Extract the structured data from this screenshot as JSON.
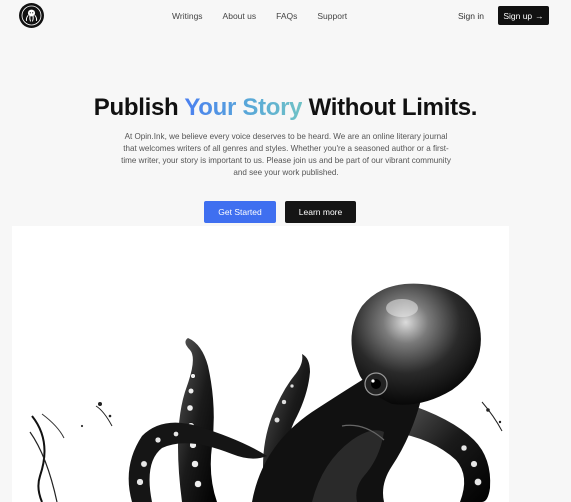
{
  "header": {
    "logo": "octopus-logo-icon",
    "nav": [
      "Writings",
      "About us",
      "FAQs",
      "Support"
    ],
    "signin_label": "Sign in",
    "signup_label": "Sign up",
    "signup_icon": "arrow-right-icon",
    "signup_icon_glyph": "→"
  },
  "hero": {
    "title_start": "Publish ",
    "title_highlight": "Your Story",
    "title_end": " Without Limits.",
    "description": "At Opin.Ink, we believe every voice deserves to be heard. We are an online literary journal that welcomes writers of all genres and styles. Whether you're a seasoned author or a first-time writer, your story is important to us. Please join us and be part of our vibrant community and see your work published.",
    "primary_button": "Get Started",
    "secondary_button": "Learn more"
  },
  "colors": {
    "accent": "#3f6ff0",
    "gradient_start": "#4a7ff0",
    "gradient_end": "#6fc2c6",
    "dark": "#111111"
  },
  "illustration": {
    "icon": "octopus-illustration"
  }
}
